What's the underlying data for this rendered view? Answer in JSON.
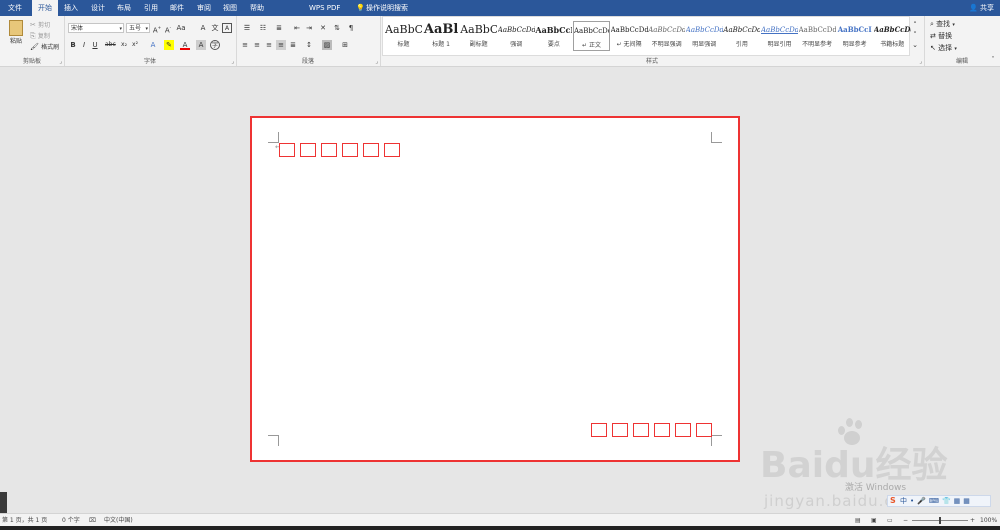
{
  "tabs": [
    "文件",
    "开始",
    "插入",
    "设计",
    "布局",
    "引用",
    "邮件",
    "审阅",
    "视图",
    "帮助",
    "WPS PDF",
    "操作说明搜索"
  ],
  "active_tab": "开始",
  "share_label": "共享",
  "clipboard": {
    "paste": "粘贴",
    "cut": "剪切",
    "copy": "复制",
    "format_painter": "格式刷",
    "group": "剪贴板"
  },
  "font": {
    "name": "宋体",
    "size": "五号",
    "group": "字体"
  },
  "paragraph": {
    "group": "段落"
  },
  "styles": {
    "group": "样式",
    "items": [
      {
        "sample": "AaBbC",
        "name": "标题"
      },
      {
        "sample": "AaBl",
        "name": "标题 1"
      },
      {
        "sample": "AaBbC",
        "name": "副标题"
      },
      {
        "sample": "AaBbCcDd",
        "name": "强调"
      },
      {
        "sample": "AaBbCcD",
        "name": "要点"
      },
      {
        "sample": "AaBbCcDd",
        "name": "↵ 正文"
      },
      {
        "sample": "AaBbCcDd",
        "name": "↵ 无间隔"
      },
      {
        "sample": "AaBbCcDd",
        "name": "不明显强调"
      },
      {
        "sample": "AaBbCcDd",
        "name": "明显强调"
      },
      {
        "sample": "AaBbCcDd",
        "name": "引用"
      },
      {
        "sample": "AaBbCcDd",
        "name": "明显引用"
      },
      {
        "sample": "AaBbCcDd",
        "name": "不明显参考"
      },
      {
        "sample": "AaBbCcI",
        "name": "明显参考"
      },
      {
        "sample": "AaBbCcDd",
        "name": "书籍标题"
      }
    ]
  },
  "editing": {
    "find": "查找",
    "replace": "替换",
    "select": "选择",
    "group": "编辑"
  },
  "status": {
    "page": "第 1 页，共 1 页",
    "words": "0 个字",
    "language": "中文(中国)",
    "zoom": "100%"
  },
  "watermark": {
    "brand": "Baidu经验",
    "url": "jingyan.baidu.com",
    "activate": "激活 Windows"
  }
}
